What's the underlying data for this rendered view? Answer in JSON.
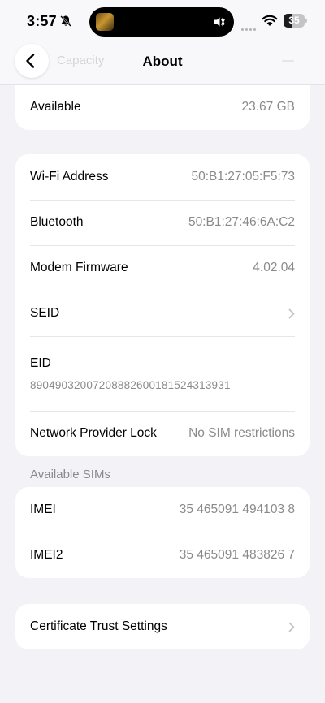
{
  "status_bar": {
    "time": "3:57",
    "battery": "35"
  },
  "nav": {
    "title": "About",
    "back_icon": "chevron-left-icon"
  },
  "storage_group": {
    "rows": [
      {
        "label": "Available",
        "value": "23.67 GB"
      }
    ]
  },
  "network_group": {
    "rows": [
      {
        "label": "Wi-Fi Address",
        "value": "50:B1:27:05:F5:73"
      },
      {
        "label": "Bluetooth",
        "value": "50:B1:27:46:6A:C2"
      },
      {
        "label": "Modem Firmware",
        "value": "4.02.04"
      },
      {
        "label": "SEID",
        "value": ""
      },
      {
        "label": "EID",
        "value": "89049032007208882600181524313931"
      },
      {
        "label": "Network Provider Lock",
        "value": "No SIM restrictions"
      }
    ]
  },
  "sims_section": {
    "header": "Available SIMs",
    "rows": [
      {
        "label": "IMEI",
        "value": "35 465091 494103 8"
      },
      {
        "label": "IMEI2",
        "value": "35 465091 483826 7"
      }
    ]
  },
  "certificate_group": {
    "rows": [
      {
        "label": "Certificate Trust Settings",
        "value": ""
      }
    ]
  },
  "colors": {
    "background": "#f2f2f7",
    "card": "#ffffff",
    "secondary_text": "#8a8a8e",
    "separator": "#e5e5ea"
  }
}
